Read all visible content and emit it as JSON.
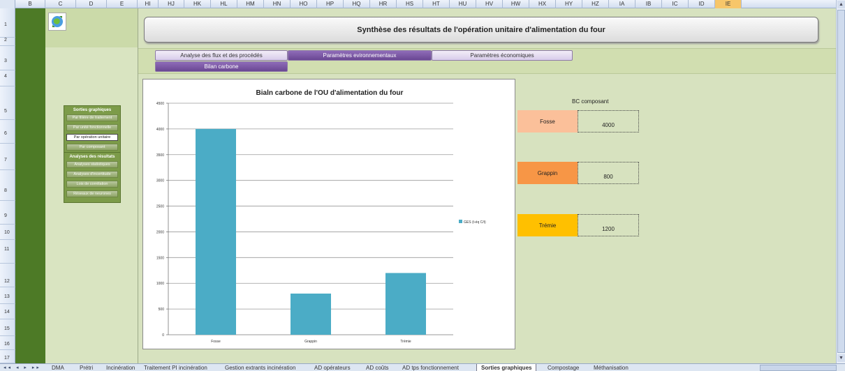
{
  "columns": [
    "B",
    "C",
    "D",
    "E",
    "HI",
    "HJ",
    "HK",
    "HL",
    "HM",
    "HN",
    "HO",
    "HP",
    "HQ",
    "HR",
    "HS",
    "HT",
    "HU",
    "HV",
    "HW",
    "HX",
    "HY",
    "HZ",
    "IA",
    "IB",
    "IC",
    "ID",
    "IE"
  ],
  "rows": [
    "1",
    "2",
    "3",
    "4",
    "5",
    "6",
    "7",
    "8",
    "9",
    "10",
    "11",
    "12",
    "13",
    "14",
    "15",
    "16",
    "17"
  ],
  "header": {
    "title": "Synthèse des résultats de l'opération unitaire d'alimentation du four"
  },
  "tabs": {
    "flux": "Analyse des flux et des procédés",
    "env": "Paramètres evironnementaux",
    "eco": "Paramètres économiques",
    "bilan": "Bilan carbone"
  },
  "nav": {
    "sorties": {
      "title": "Sorties graphiques",
      "items": [
        "Par filière de traitement",
        "Par unité fonctionnelle",
        "Par opération unitaire",
        "Par composant"
      ]
    },
    "analyses": {
      "title": "Analyses des résultats",
      "items": [
        "Analyses statistiques",
        "Analyses d'incertitude",
        "Lois de corrélation",
        "Réseaux de neurones"
      ]
    }
  },
  "chart_data": {
    "type": "bar",
    "title": "Bialn carbone de l'OU d'alimentation du four",
    "categories": [
      "Fosse",
      "Grappin",
      "Trémie"
    ],
    "series": [
      {
        "name": "GES (t-éq C/t)",
        "values": [
          4000,
          800,
          1200
        ]
      }
    ],
    "ylim": [
      0,
      4500
    ],
    "yticks": [
      0,
      500,
      1000,
      1500,
      2000,
      2500,
      3000,
      3500,
      4000,
      4500
    ],
    "grid": true,
    "legend": "right",
    "bar_color": "#4bacc6"
  },
  "bc": {
    "title": "BC composant",
    "items": [
      {
        "label": "Fosse",
        "value": "4000",
        "color": "#fbc09a"
      },
      {
        "label": "Grappin",
        "value": "800",
        "color": "#f79646"
      },
      {
        "label": "Trémie",
        "value": "1200",
        "color": "#ffc000"
      }
    ]
  },
  "sheet_tabs": [
    "DMA",
    "Prétri",
    "Incinération",
    "Traitement PI incinération",
    "Gestion extrants incinération",
    "AD opérateurs",
    "AD coûts",
    "AD tps fonctionnement",
    "Sorties graphiques",
    "Compostage",
    "Méthanisation"
  ],
  "active_sheet": "Sorties graphiques"
}
